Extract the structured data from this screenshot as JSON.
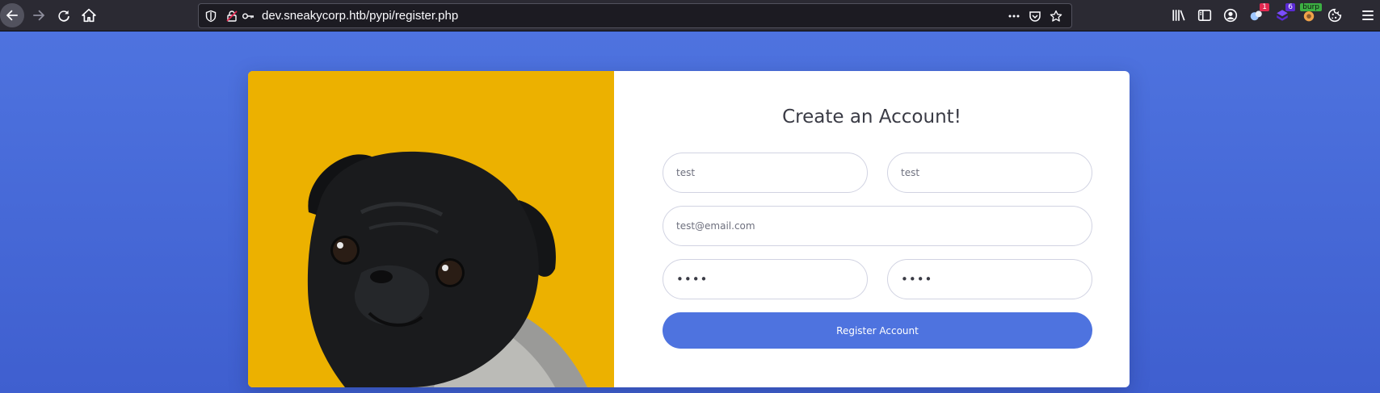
{
  "browser": {
    "url": "dev.sneakycorp.htb/pypi/register.php",
    "extensions": [
      {
        "name": "library",
        "badge": ""
      },
      {
        "name": "sidebar",
        "badge": ""
      },
      {
        "name": "account",
        "badge": ""
      },
      {
        "name": "extension-1",
        "badge": "1",
        "badge_color": "#e22850"
      },
      {
        "name": "extension-2",
        "badge": "6",
        "badge_color": "#5b2ad4"
      },
      {
        "name": "burp",
        "badge": "burp",
        "badge_color": "#3cb043"
      },
      {
        "name": "cookie",
        "badge": ""
      }
    ]
  },
  "form": {
    "title": "Create an Account!",
    "first_name": "test",
    "last_name": "test",
    "email": "test@email.com",
    "password": "••••",
    "repeat_password": "••••",
    "submit_label": "Register Account"
  },
  "colors": {
    "accent": "#4e73df",
    "photo_bg": "#ecb100"
  }
}
